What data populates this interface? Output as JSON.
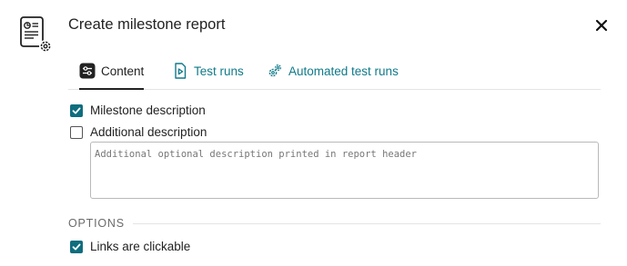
{
  "dialog": {
    "title": "Create milestone report",
    "icon": "report-settings-icon"
  },
  "tabs": [
    {
      "label": "Content",
      "icon": "sliders-icon",
      "active": true
    },
    {
      "label": "Test runs",
      "icon": "play-document-icon",
      "active": false
    },
    {
      "label": "Automated test runs",
      "icon": "gears-icon",
      "active": false
    }
  ],
  "content": {
    "milestone_description": {
      "label": "Milestone description",
      "checked": true
    },
    "additional_description": {
      "label": "Additional description",
      "checked": false,
      "placeholder": "Additional optional description printed in report header",
      "value": ""
    }
  },
  "options": {
    "heading": "OPTIONS",
    "links_clickable": {
      "label": "Links are clickable",
      "checked": true
    }
  },
  "colors": {
    "accent": "#0f6d7e",
    "tab_link": "#0f7a8a",
    "text": "#222222"
  }
}
